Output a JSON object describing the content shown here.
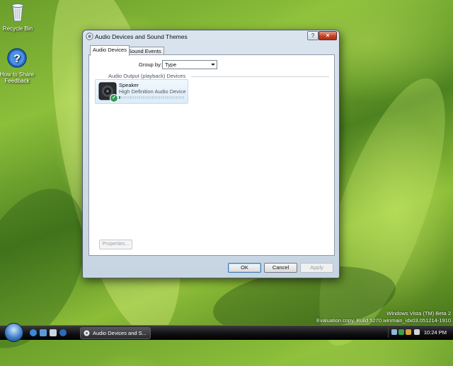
{
  "desktop": {
    "icons": [
      {
        "label": "Recycle Bin",
        "icon": "recycle-bin-icon"
      },
      {
        "label": "How to Share Feedback",
        "icon": "help-icon"
      }
    ]
  },
  "window": {
    "title": "Audio Devices and Sound Themes",
    "help_label": "?",
    "close_label": "×",
    "tabs": [
      {
        "label": "Audio Devices",
        "active": true
      },
      {
        "label": "Sound Events",
        "active": false
      }
    ],
    "group_by": {
      "label": "Group by:",
      "value": "Type"
    },
    "section_title": "Audio Output (playback) Devices",
    "device": {
      "name": "Speaker",
      "description": "High Definition Audio Device",
      "icon": "speaker-icon",
      "status_icon": "check-icon",
      "level": 0.03
    },
    "properties_label": "Properties...",
    "buttons": {
      "ok": "OK",
      "cancel": "Cancel",
      "apply": "Apply"
    }
  },
  "watermark": {
    "line1": "Windows Vista (TM) Beta 2",
    "line2": "Evaluation copy. Build 5270.winmain_idx03.051214-1910"
  },
  "taskbar": {
    "task_label": "Audio Devices and S...",
    "clock": "10:24 PM"
  },
  "colors": {
    "accent": "#3c7fb1",
    "close_red": "#c63b22",
    "ok_green": "#2c9a55"
  }
}
